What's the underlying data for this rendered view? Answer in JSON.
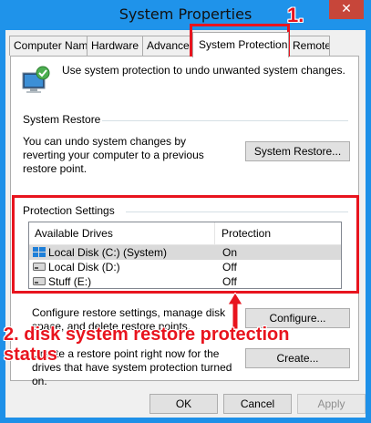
{
  "window": {
    "title": "System Properties",
    "close_glyph": "✕"
  },
  "tabs": [
    "Computer Name",
    "Hardware",
    "Advanced",
    "System Protection",
    "Remote"
  ],
  "active_tab": "System Protection",
  "intro": {
    "text": "Use system protection to undo unwanted system changes.",
    "icon": "computer-protection-icon"
  },
  "system_restore": {
    "section_label": "System Restore",
    "description": "You can undo system changes by reverting your computer to a previous restore point.",
    "button_label": "System Restore..."
  },
  "protection_settings": {
    "section_label": "Protection Settings",
    "columns": [
      "Available Drives",
      "Protection"
    ],
    "drives": [
      {
        "name": "Local Disk (C:) (System)",
        "protection": "On",
        "icon": "windows-drive-icon",
        "selected": true
      },
      {
        "name": "Local Disk (D:)",
        "protection": "Off",
        "icon": "drive-icon",
        "selected": false
      },
      {
        "name": "Stuff (E:)",
        "protection": "Off",
        "icon": "drive-icon",
        "selected": false
      }
    ]
  },
  "configure": {
    "description": "Configure restore settings, manage disk space, and delete restore points.",
    "button_label": "Configure..."
  },
  "create": {
    "description": "Create a restore point right now for the drives that have system protection turned on.",
    "button_label": "Create..."
  },
  "footer": {
    "ok": "OK",
    "cancel": "Cancel",
    "apply": "Apply"
  },
  "annotations": {
    "step1": "1.",
    "step2_line1": "2. disk system restore protection",
    "step2_line2": "status",
    "color": "#e8141e"
  }
}
